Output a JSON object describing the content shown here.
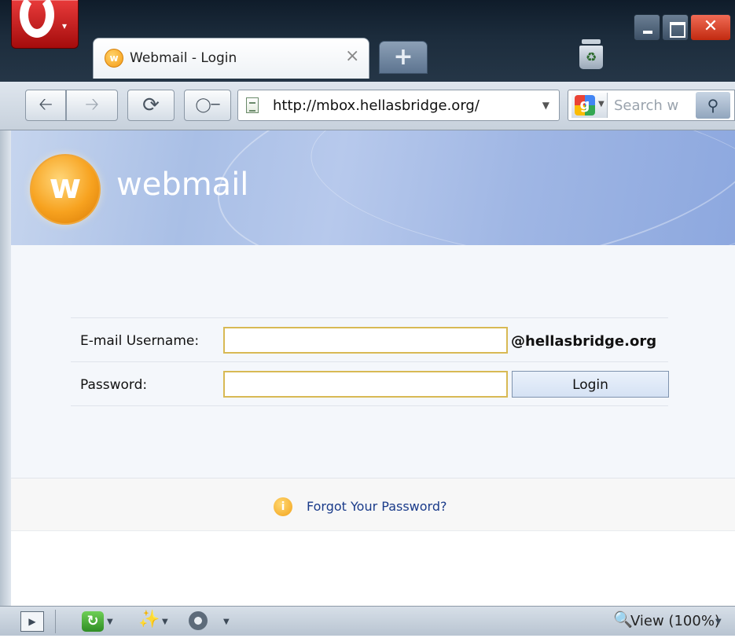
{
  "browser": {
    "tab_title": "Webmail - Login",
    "tab_favicon_letter": "w",
    "address_url": "http://mbox.hellasbridge.org/",
    "search_placeholder": "Search w",
    "status_zoom": "View (100%)"
  },
  "banner": {
    "logo_letter": "w",
    "logo_text": "webmail"
  },
  "login_form": {
    "username_label": "E-mail Username:",
    "username_value": "",
    "domain_suffix": "@hellasbridge.org",
    "password_label": "Password:",
    "password_value": "",
    "login_button": "Login"
  },
  "forgot": {
    "link_text": "Forgot Your Password?"
  },
  "icons": {
    "back": "arrow-left-icon",
    "forward": "arrow-right-icon",
    "reload": "reload-icon",
    "key": "key-icon",
    "trash": "trash-icon",
    "search": "magnifier-icon",
    "info": "info-icon"
  },
  "colors": {
    "opera_red": "#c81d1d",
    "logo_orange": "#f7a21f",
    "field_border": "#d8b954",
    "link_blue": "#1a3b8a"
  }
}
